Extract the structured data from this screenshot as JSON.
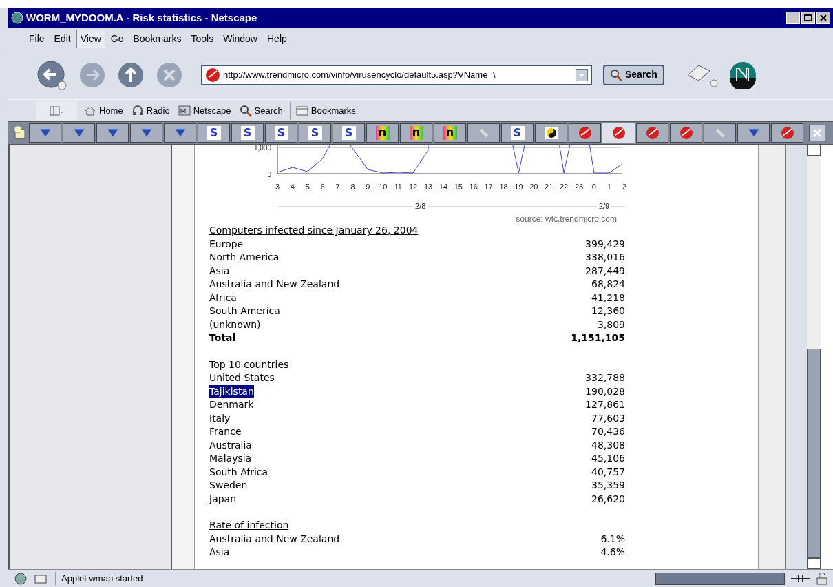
{
  "window": {
    "title": "WORM_MYDOOM.A - Risk statistics - Netscape"
  },
  "menu": [
    {
      "label": "File",
      "selected": false
    },
    {
      "label": "Edit",
      "selected": false
    },
    {
      "label": "View",
      "selected": true
    },
    {
      "label": "Go",
      "selected": false
    },
    {
      "label": "Bookmarks",
      "selected": false
    },
    {
      "label": "Tools",
      "selected": false
    },
    {
      "label": "Window",
      "selected": false
    },
    {
      "label": "Help",
      "selected": false
    }
  ],
  "navigation": {
    "url": "http://www.trendmicro.com/vinfo/virusencyclo/default5.asp?VName=\\",
    "search_button": "Search"
  },
  "personal_toolbar": [
    {
      "kind": "home",
      "label": "Home"
    },
    {
      "kind": "radio",
      "label": "Radio"
    },
    {
      "kind": "netscape",
      "label": "Netscape"
    },
    {
      "kind": "search",
      "label": "Search"
    },
    {
      "kind": "bookmarks",
      "label": "Bookmarks"
    }
  ],
  "tabs": [
    {
      "kind": "triangle",
      "selected": false
    },
    {
      "kind": "triangle",
      "selected": false
    },
    {
      "kind": "triangle",
      "selected": false
    },
    {
      "kind": "triangle",
      "selected": false
    },
    {
      "kind": "triangle",
      "selected": false
    },
    {
      "kind": "s",
      "glyph": "S",
      "selected": false
    },
    {
      "kind": "s",
      "glyph": "S",
      "selected": false
    },
    {
      "kind": "s",
      "glyph": "S",
      "selected": false
    },
    {
      "kind": "s",
      "glyph": "S",
      "selected": false
    },
    {
      "kind": "s",
      "glyph": "S",
      "selected": false
    },
    {
      "kind": "n",
      "glyph": "n",
      "selected": false
    },
    {
      "kind": "n",
      "glyph": "n",
      "selected": false
    },
    {
      "kind": "n",
      "glyph": "n",
      "selected": false
    },
    {
      "kind": "pen",
      "selected": false
    },
    {
      "kind": "s",
      "glyph": "S",
      "selected": false
    },
    {
      "kind": "yinyang",
      "selected": false
    },
    {
      "kind": "ball",
      "selected": false
    },
    {
      "kind": "ball",
      "selected": true
    },
    {
      "kind": "ball",
      "selected": false
    },
    {
      "kind": "ball",
      "selected": false
    },
    {
      "kind": "pen",
      "selected": false
    },
    {
      "kind": "triangle",
      "selected": false
    },
    {
      "kind": "ball",
      "selected": false
    }
  ],
  "chart": {
    "y_labels": [
      "1,000",
      "0"
    ],
    "x_labels": [
      "3",
      "4",
      "5",
      "6",
      "7",
      "8",
      "9",
      "10",
      "11",
      "12",
      "13",
      "14",
      "15",
      "16",
      "17",
      "18",
      "19",
      "20",
      "21",
      "22",
      "23",
      "0",
      "1",
      "2"
    ],
    "date_labels": [
      "2/8",
      "2/9"
    ],
    "source": "source: wtc.trendmicro.com"
  },
  "sections": [
    {
      "heading": "Computers infected since January 26, 2004",
      "rows": [
        {
          "name": "Europe",
          "value": "399,429"
        },
        {
          "name": "North America",
          "value": "338,016"
        },
        {
          "name": "Asia",
          "value": "287,449"
        },
        {
          "name": "Australia and New Zealand",
          "value": "68,824"
        },
        {
          "name": "Africa",
          "value": "41,218"
        },
        {
          "name": "South America",
          "value": "12,360"
        },
        {
          "name": "(unknown)",
          "value": "3,809"
        }
      ],
      "total": {
        "name": "Total",
        "value": "1,151,105"
      }
    },
    {
      "heading": "Top 10 countries",
      "rows": [
        {
          "name": "United States",
          "value": "332,788"
        },
        {
          "name": "Tajikistan",
          "value": "190,028",
          "selected": true
        },
        {
          "name": "Denmark",
          "value": "127,861"
        },
        {
          "name": "Italy",
          "value": "77,603"
        },
        {
          "name": "France",
          "value": "70,436"
        },
        {
          "name": "Australia",
          "value": "48,308"
        },
        {
          "name": "Malaysia",
          "value": "45,106"
        },
        {
          "name": "South Africa",
          "value": "40,757"
        },
        {
          "name": "Sweden",
          "value": "35,359"
        },
        {
          "name": "Japan",
          "value": "26,620"
        }
      ]
    },
    {
      "heading": "Rate of infection",
      "rows": [
        {
          "name": "Australia and New Zealand",
          "value": "6.1%"
        },
        {
          "name": "Asia",
          "value": "4.6%"
        }
      ]
    }
  ],
  "status_bar": {
    "text": "Applet wmap started",
    "level": 1
  }
}
